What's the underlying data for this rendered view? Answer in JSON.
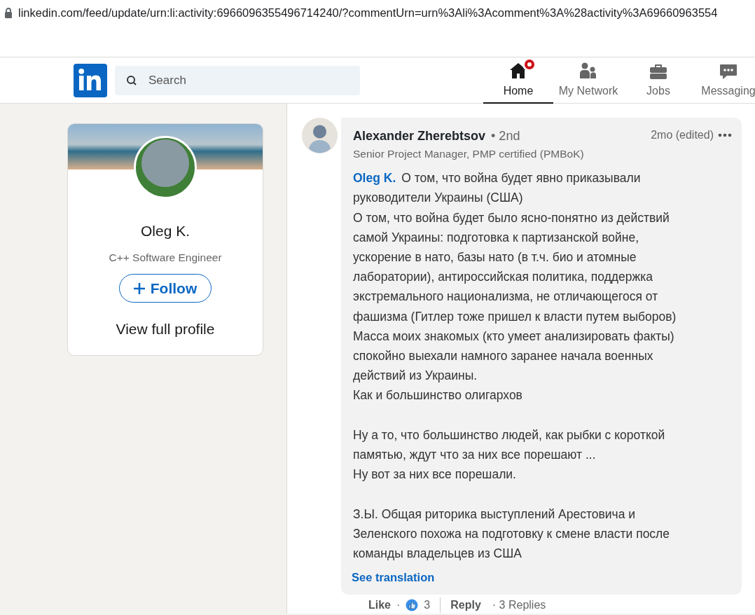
{
  "browser": {
    "url": "linkedin.com/feed/update/urn:li:activity:6966096355496714240/?commentUrn=urn%3Ali%3Acomment%3A%28activity%3A69660963554"
  },
  "nav": {
    "search": {
      "placeholder": "Search"
    },
    "items": [
      {
        "kind": "home",
        "label": "Home",
        "selected": true,
        "notification": true
      },
      {
        "kind": "network",
        "label": "My Network",
        "selected": false,
        "notification": false
      },
      {
        "kind": "jobs",
        "label": "Jobs",
        "selected": false,
        "notification": false
      },
      {
        "kind": "messaging",
        "label": "Messaging",
        "selected": false,
        "notification": false
      }
    ]
  },
  "profile": {
    "name": "Oleg K.",
    "headline": "C++ Software Engineer",
    "follow": "Follow",
    "view_profile": "View full profile"
  },
  "comment": {
    "author": "Alexander Zherebtsov",
    "degree": "• 2nd",
    "headline": "Senior Project Manager, PMP certified (PMBoK)",
    "time": "2mo (edited)",
    "mention": "Oleg K.",
    "paragraphs": [
      [
        "О том, что война будет явно приказывали",
        "руководители Украины (США)",
        "О том, что война будет было ясно-понятно из действий",
        "самой Украины: подготовка к партизанской войне,",
        "ускорение в нато, базы нато (в т.ч. био и атомные",
        "лаборатории), антироссийская политика, поддержка",
        "экстремального национализма, не отличающегося от",
        "фашизма (Гитлер тоже пришел к власти путем выборов)",
        "Масса моих знакомых (кто умеет анализировать факты)",
        "спокойно выехали намного заранее начала военных",
        "действий из Украины.",
        "Как и большинство олигархов"
      ],
      [
        "Ну а то, что большинство людей, как рыбки с короткой",
        "памятью, ждут что за них все порешают ...",
        "Ну вот за них все порешали."
      ],
      [
        "З.Ы. Общая риторика выступлений Арестовича и",
        "Зеленского похожа на подготовку к смене власти после",
        "команды владельцев из США"
      ]
    ],
    "translate": "See translation",
    "actions": {
      "like": "Like",
      "like_sep": "·",
      "like_count": "3",
      "reply": "Reply",
      "replies": "· 3 Replies"
    }
  }
}
